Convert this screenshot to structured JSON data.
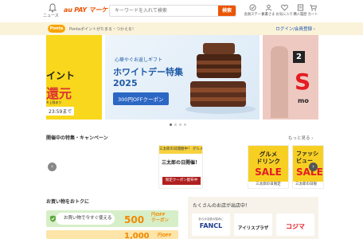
{
  "header": {
    "notification_label": "ニュース",
    "logo_text": "au PAY マーケット",
    "search_placeholder": "キーワードを入れて検索",
    "search_button": "検索",
    "icons": [
      {
        "name": "status-icon",
        "label": "会員ステータス"
      },
      {
        "name": "account-icon",
        "label": "お客さま"
      },
      {
        "name": "favorite-icon",
        "label": "お気に入り"
      },
      {
        "name": "history-icon",
        "label": "購入履歴"
      },
      {
        "name": "cart-icon",
        "label": "カート"
      }
    ]
  },
  "points_bar": {
    "ponta_label": "Ponta",
    "text": "Pontaポイントがたまる・つかえる！",
    "login_link": "ログイン/会員登録"
  },
  "banners": {
    "left": {
      "line1": "イント",
      "line2": "還元",
      "line3": "※上限あり",
      "line4": "23:59まで"
    },
    "main": {
      "sub": "心華やぐお返しギフト",
      "title": "ホワイトデー特集 2025",
      "coupon": "300円OFFクーポン"
    },
    "right": {
      "tag": "2",
      "sale": "S",
      "foot": "mo"
    }
  },
  "campaign": {
    "title": "開催中の特集・キャンペーン",
    "more": "もっと見る",
    "cards": [
      {
        "top": "三太郎の日開催中！ グルメ",
        "mid": "三太郎の日開催！",
        "bot": "限定クーポン配布中"
      },
      {
        "line1": "グルメ",
        "line2": "ドリンク",
        "sale": "SALE",
        "foot": "三太郎の日限定"
      },
      {
        "line1": "ファッシ",
        "line2": "ビュー",
        "sale": "SALE",
        "foot": "三太郎の日限"
      }
    ]
  },
  "deals": {
    "title": "お買い物をおトクに",
    "items": [
      {
        "label": "お買い物で今すぐ使える",
        "value": "500",
        "unit1": "円OFF",
        "unit2": "クーポン"
      },
      {
        "label": "",
        "value": "1,000",
        "unit1": "円OFF",
        "unit2": ""
      }
    ]
  },
  "stores": {
    "title": "たくさんのお店が出店中！",
    "items": [
      {
        "tagline": "あらゆる肌の悩みに",
        "name": "FANCL"
      },
      {
        "tagline": "",
        "name": "アイリスプラザ"
      },
      {
        "tagline": "",
        "name": "コジマ"
      }
    ]
  },
  "colors": {
    "accent": "#eb5505",
    "link": "#1a56b0",
    "banner_blue": "#1f5aa6",
    "sale_red": "#e31b23"
  }
}
